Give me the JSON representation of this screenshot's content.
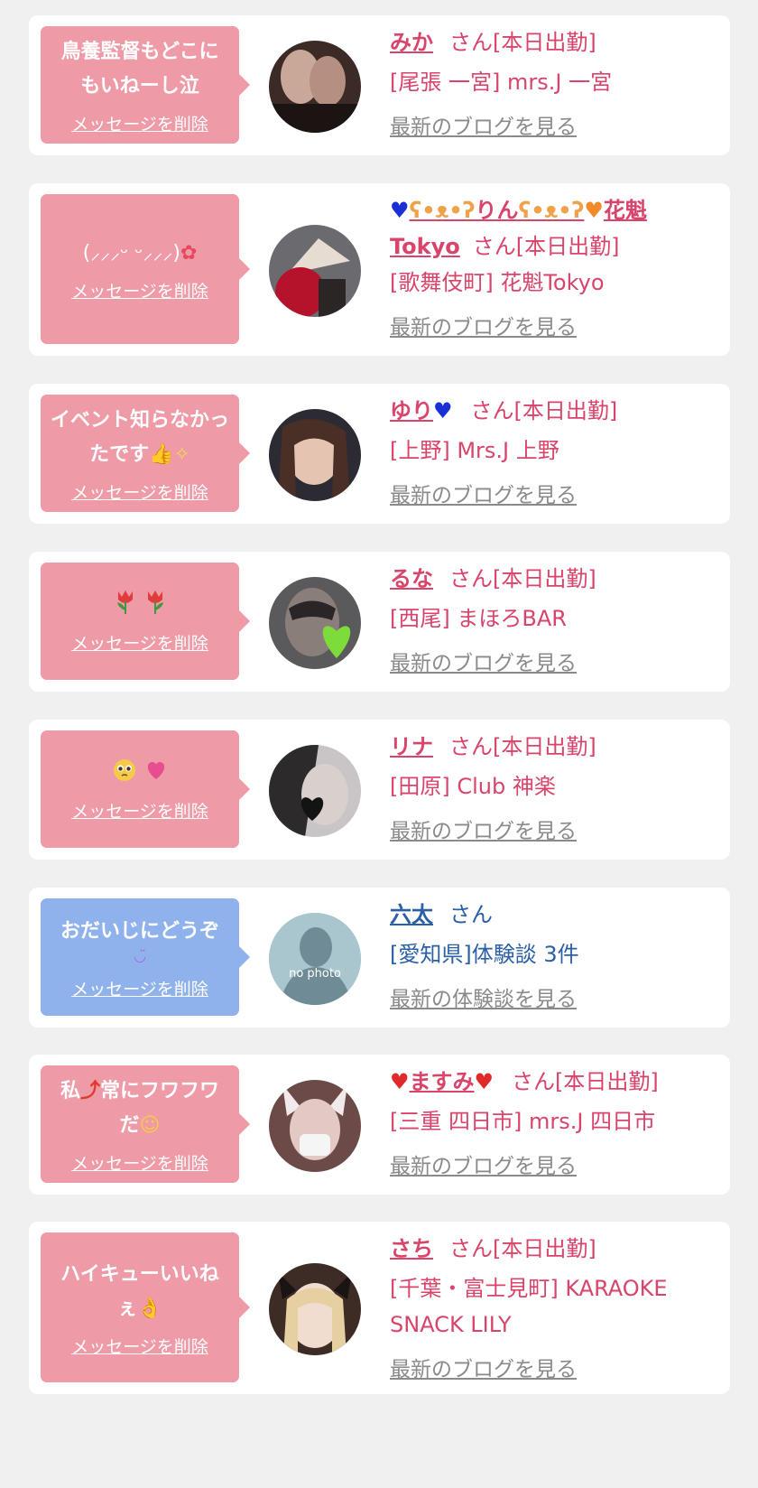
{
  "cards": [
    {
      "message": "鳥養監督もどこにもいねーし泣",
      "delete_label": "メッセージを削除",
      "name": "みか",
      "suffix": "さん[本日出勤]",
      "shop": "[尾張 一宮] mrs.J 一宮",
      "link": "最新のブログを見る"
    },
    {
      "message": "(⸝⸝⸝ᵕ ᵕ⸝⸝⸝)",
      "delete_label": "メッセージを削除",
      "name_left_icon": "blue-heart-icon",
      "name": "りん",
      "name_tail": "花魁Tokyo",
      "suffix": "さん[本日出勤]",
      "shop": "[歌舞伎町] 花魁Tokyo",
      "link": "最新のブログを見る"
    },
    {
      "message": "イベント知らなかったです",
      "delete_label": "メッセージを削除",
      "name": "ゆり",
      "suffix": "さん[本日出勤]",
      "shop": "[上野] Mrs.J 上野",
      "link": "最新のブログを見る"
    },
    {
      "message": "tulip-icon tulip-icon",
      "delete_label": "メッセージを削除",
      "name": "るな",
      "suffix": "さん[本日出勤]",
      "shop": "[西尾] まほろBAR",
      "link": "最新のブログを見る"
    },
    {
      "message": "pleading-face-icon pink-heart-icon",
      "delete_label": "メッセージを削除",
      "name": "リナ",
      "suffix": "さん[本日出勤]",
      "shop": "[田原] Club 神楽",
      "link": "最新のブログを見る"
    },
    {
      "message": "おだいじにどうぞ",
      "delete_label": "メッセージを削除",
      "name": "六太",
      "suffix": "さん",
      "shop": "[愛知県]体験談 3件",
      "link": "最新の体験談を見る",
      "avatar_text": "no photo"
    },
    {
      "message": "私",
      "message_tail": "常にフワフワだ",
      "delete_label": "メッセージを削除",
      "name": "ますみ",
      "suffix": "さん[本日出勤]",
      "shop": "[三重 四日市] mrs.J 四日市",
      "link": "最新のブログを見る"
    },
    {
      "message": "ハイキューいいねぇ",
      "delete_label": "メッセージを削除",
      "name": "さち",
      "suffix": "さん[本日出勤]",
      "shop": "[千葉・富士見町] KARAOKE SNACK LILY",
      "link": "最新のブログを見る"
    }
  ],
  "colors": {
    "pink_bubble": "#ee9aa7",
    "blue_bubble": "#8fb2ec",
    "name_pink": "#d8446a",
    "name_blue": "#2b5fa6",
    "link_gray": "#8a8a8a"
  }
}
